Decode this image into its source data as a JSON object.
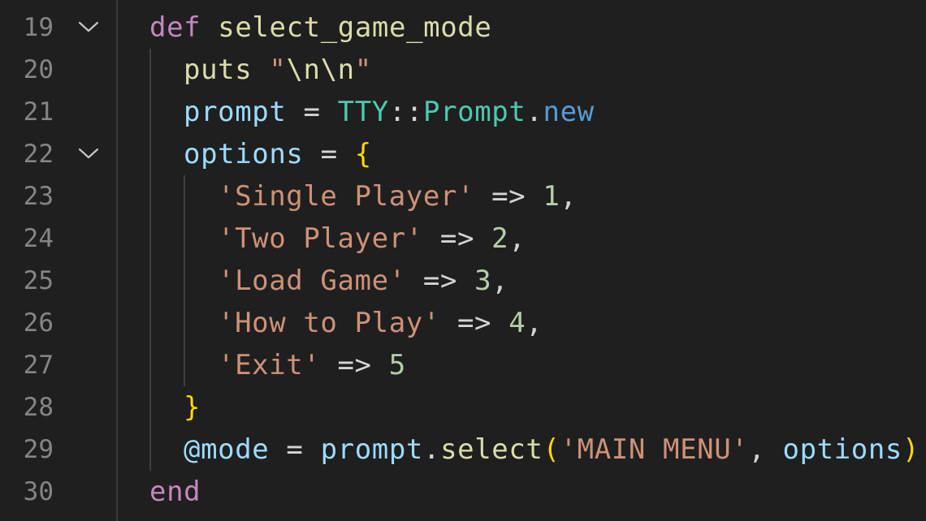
{
  "editor": {
    "lines": [
      {
        "number": "19",
        "foldable": true,
        "indent": 0,
        "tokens": [
          {
            "type": "kw",
            "text": "def"
          },
          {
            "type": "op",
            "text": " "
          },
          {
            "type": "fn",
            "text": "select_game_mode"
          }
        ]
      },
      {
        "number": "20",
        "foldable": false,
        "indent": 1,
        "tokens": [
          {
            "type": "fn",
            "text": "puts"
          },
          {
            "type": "op",
            "text": " "
          },
          {
            "type": "str",
            "text": "\""
          },
          {
            "type": "fn",
            "text": "\\n\\n"
          },
          {
            "type": "str",
            "text": "\""
          }
        ]
      },
      {
        "number": "21",
        "foldable": false,
        "indent": 1,
        "tokens": [
          {
            "type": "var",
            "text": "prompt"
          },
          {
            "type": "op",
            "text": " = "
          },
          {
            "type": "cls",
            "text": "TTY"
          },
          {
            "type": "op",
            "text": "::"
          },
          {
            "type": "cls",
            "text": "Prompt"
          },
          {
            "type": "op",
            "text": "."
          },
          {
            "type": "meth",
            "text": "new"
          }
        ]
      },
      {
        "number": "22",
        "foldable": true,
        "indent": 1,
        "tokens": [
          {
            "type": "var",
            "text": "options"
          },
          {
            "type": "op",
            "text": " = "
          },
          {
            "type": "br1",
            "text": "{"
          }
        ]
      },
      {
        "number": "23",
        "foldable": false,
        "indent": 2,
        "tokens": [
          {
            "type": "str",
            "text": "'Single Player'"
          },
          {
            "type": "op",
            "text": " => "
          },
          {
            "type": "num",
            "text": "1"
          },
          {
            "type": "op",
            "text": ","
          }
        ]
      },
      {
        "number": "24",
        "foldable": false,
        "indent": 2,
        "tokens": [
          {
            "type": "str",
            "text": "'Two Player'"
          },
          {
            "type": "op",
            "text": " => "
          },
          {
            "type": "num",
            "text": "2"
          },
          {
            "type": "op",
            "text": ","
          }
        ]
      },
      {
        "number": "25",
        "foldable": false,
        "indent": 2,
        "tokens": [
          {
            "type": "str",
            "text": "'Load Game'"
          },
          {
            "type": "op",
            "text": " => "
          },
          {
            "type": "num",
            "text": "3"
          },
          {
            "type": "op",
            "text": ","
          }
        ]
      },
      {
        "number": "26",
        "foldable": false,
        "indent": 2,
        "tokens": [
          {
            "type": "str",
            "text": "'How to Play'"
          },
          {
            "type": "op",
            "text": " => "
          },
          {
            "type": "num",
            "text": "4"
          },
          {
            "type": "op",
            "text": ","
          }
        ]
      },
      {
        "number": "27",
        "foldable": false,
        "indent": 2,
        "tokens": [
          {
            "type": "str",
            "text": "'Exit'"
          },
          {
            "type": "op",
            "text": " => "
          },
          {
            "type": "num",
            "text": "5"
          }
        ]
      },
      {
        "number": "28",
        "foldable": false,
        "indent": 1,
        "tokens": [
          {
            "type": "br1",
            "text": "}"
          }
        ]
      },
      {
        "number": "29",
        "foldable": false,
        "indent": 1,
        "tokens": [
          {
            "type": "var",
            "text": "@mode"
          },
          {
            "type": "op",
            "text": " = "
          },
          {
            "type": "var",
            "text": "prompt"
          },
          {
            "type": "op",
            "text": "."
          },
          {
            "type": "fn",
            "text": "select"
          },
          {
            "type": "br1",
            "text": "("
          },
          {
            "type": "str",
            "text": "'MAIN MENU'"
          },
          {
            "type": "op",
            "text": ", "
          },
          {
            "type": "var",
            "text": "options"
          },
          {
            "type": "br1",
            "text": ")"
          }
        ]
      },
      {
        "number": "30",
        "foldable": false,
        "indent": 0,
        "tokens": [
          {
            "type": "kw",
            "text": "end"
          }
        ]
      }
    ],
    "icons": {
      "fold": "chevron-down-icon"
    },
    "colors": {
      "background": "#1f1f1f",
      "line_number": "#858585",
      "keyword": "#c586c0",
      "function": "#dcdcaa",
      "string": "#ce9178",
      "variable": "#9cdcfe",
      "class": "#4ec9b0",
      "method": "#569cd6",
      "number": "#b5cea8",
      "bracket": "#ffd700"
    }
  }
}
